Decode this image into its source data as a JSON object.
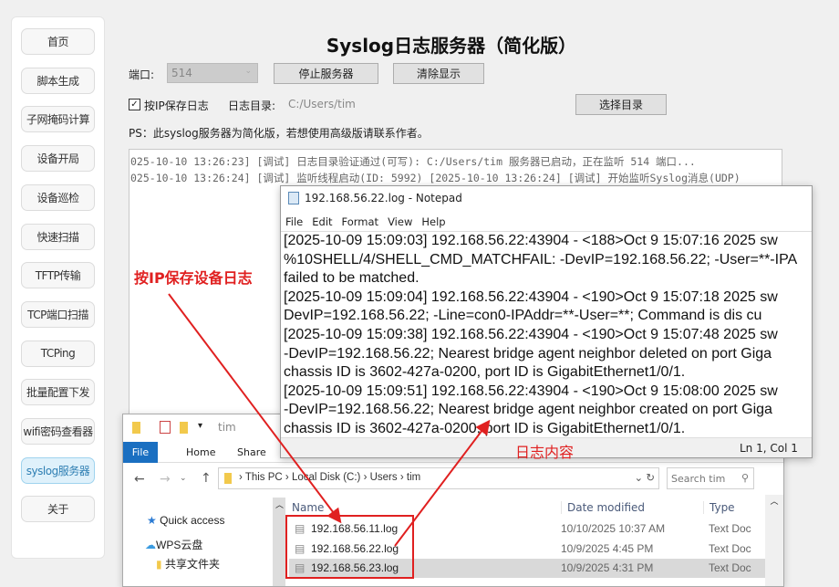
{
  "sidebar": {
    "items": [
      {
        "label": "首页"
      },
      {
        "label": "脚本生成"
      },
      {
        "label": "子网掩码计算"
      },
      {
        "label": "设备开局"
      },
      {
        "label": "设备巡检"
      },
      {
        "label": "快速扫描"
      },
      {
        "label": "TFTP传输"
      },
      {
        "label": "TCP端口扫描"
      },
      {
        "label": "TCPing"
      },
      {
        "label": "批量配置下发"
      },
      {
        "label": "wifi密码查看器"
      },
      {
        "label": "syslog服务器"
      },
      {
        "label": "关于"
      }
    ],
    "active_index": 11
  },
  "main": {
    "title": "Syslog日志服务器（简化版）",
    "port_label": "端口:",
    "port_value": "514",
    "stop_button": "停止服务器",
    "clear_button": "清除显示",
    "save_by_ip_label": "按IP保存日志",
    "save_by_ip_checked": true,
    "log_dir_label": "日志目录:",
    "log_dir_value": "C:/Users/tim",
    "choose_dir_button": "选择目录",
    "ps_note": "PS：此syslog服务器为简化版，若想使用高级版请联系作者。",
    "log_lines": [
      "025-10-10 13:26:23] [调试] 日志目录验证通过(可写): C:/Users/tim 服务器已启动，正在监听 514 端口...",
      "025-10-10 13:26:24] [调试] 监听线程启动(ID: 5992) [2025-10-10 13:26:24] [调试] 开始监听Syslog消息(UDP)"
    ]
  },
  "notepad": {
    "title": "192.168.56.22.log - Notepad",
    "menu": [
      "File",
      "Edit",
      "Format",
      "View",
      "Help"
    ],
    "lines": [
      "[2025-10-09 15:09:03] 192.168.56.22:43904 - <188>Oct  9 15:07:16 2025 sw",
      "%10SHELL/4/SHELL_CMD_MATCHFAIL: -DevIP=192.168.56.22; -User=**-IPA",
      "failed to be matched.",
      "[2025-10-09 15:09:04] 192.168.56.22:43904 - <190>Oct  9 15:07:18 2025 sw",
      "DevIP=192.168.56.22; -Line=con0-IPAddr=**-User=**; Command is dis cu",
      "[2025-10-09 15:09:38] 192.168.56.22:43904 - <190>Oct  9 15:07:48 2025 sw",
      "-DevIP=192.168.56.22; Nearest bridge agent neighbor deleted on port Giga",
      "chassis ID is 3602-427a-0200, port ID is GigabitEthernet1/0/1.",
      "[2025-10-09 15:09:51] 192.168.56.22:43904 - <190>Oct  9 15:08:00 2025 sw",
      "-DevIP=192.168.56.22; Nearest bridge agent neighbor created on port Giga",
      "chassis ID is 3602-427a-0200, port ID is GigabitEthernet1/0/1."
    ],
    "status": "Ln 1, Col 1"
  },
  "explorer": {
    "title": "tim",
    "tabs": [
      "File",
      "Home",
      "Share"
    ],
    "breadcrumb": [
      "This PC",
      "Local Disk (C:)",
      "Users",
      "tim"
    ],
    "search_placeholder": "Search tim",
    "nav": [
      "Quick access",
      "WPS云盘",
      "共享文件夹"
    ],
    "columns": [
      "Name",
      "Date modified",
      "Type"
    ],
    "files": [
      {
        "name": "192.168.56.11.log",
        "date": "10/10/2025 10:37 AM",
        "type": "Text Doc"
      },
      {
        "name": "192.168.56.22.log",
        "date": "10/9/2025 4:45 PM",
        "type": "Text Doc"
      },
      {
        "name": "192.168.56.23.log",
        "date": "10/9/2025 4:31 PM",
        "type": "Text Doc"
      }
    ],
    "selected_index": 2
  },
  "annotations": {
    "left": "按IP保存设备日志",
    "right": "日志内容",
    "color": "#e02020"
  }
}
